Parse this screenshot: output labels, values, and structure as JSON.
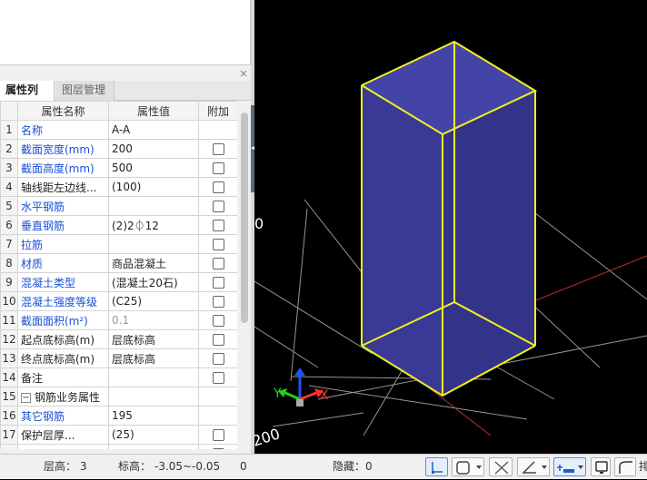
{
  "tabs": {
    "attributes": "属性列表",
    "layers": "图层管理"
  },
  "table": {
    "headers": {
      "num": "",
      "name": "属性名称",
      "value": "属性值",
      "add": "附加"
    },
    "rows": [
      {
        "num": "1",
        "name": "名称",
        "value": "A-A"
      },
      {
        "num": "2",
        "name": "截面宽度(mm)",
        "value": "200"
      },
      {
        "num": "3",
        "name": "截面高度(mm)",
        "value": "500"
      },
      {
        "num": "4",
        "name": "轴线距左边线...",
        "value": "(100)"
      },
      {
        "num": "5",
        "name": "水平钢筋",
        "value": ""
      },
      {
        "num": "6",
        "name": "垂直钢筋",
        "value": "(2)2⏀12"
      },
      {
        "num": "7",
        "name": "拉筋",
        "value": ""
      },
      {
        "num": "8",
        "name": "材质",
        "value": "商品混凝土"
      },
      {
        "num": "9",
        "name": "混凝土类型",
        "value": "(混凝土20石)"
      },
      {
        "num": "10",
        "name": "混凝土强度等级",
        "value": "(C25)"
      },
      {
        "num": "11",
        "name": "截面面积(m²)",
        "value": "0.1"
      },
      {
        "num": "12",
        "name": "起点底标高(m)",
        "value": "层底标高"
      },
      {
        "num": "13",
        "name": "终点底标高(m)",
        "value": "层底标高"
      },
      {
        "num": "14",
        "name": "备注",
        "value": ""
      },
      {
        "num": "15",
        "name": "钢筋业务属性",
        "value": "",
        "toggle": "−"
      },
      {
        "num": "16",
        "name": "其它钢筋",
        "value": "195"
      },
      {
        "num": "17",
        "name": "保护层厚...",
        "value": "(25)"
      }
    ]
  },
  "viewport": {
    "axis_labels": {
      "x": "X",
      "y": "Y",
      "z": "Z"
    },
    "edge_text_top": "0",
    "edge_text_bottom": "200",
    "colors": {
      "box_fill": "#3a3a96",
      "box_edge": "#f0f020",
      "grid": "#c8c8c8",
      "axis_x": "#ff3030",
      "axis_y": "#20d020",
      "axis_z": "#2050ff"
    }
  },
  "status": {
    "floor_height_label": "层高：",
    "floor_height_value": "3",
    "elevation_label": "标高：",
    "elevation_value": "-3.05~-0.05",
    "count_value": "0",
    "hidden_label": "隐藏：",
    "hidden_value": "0",
    "trailing_text": "排"
  }
}
